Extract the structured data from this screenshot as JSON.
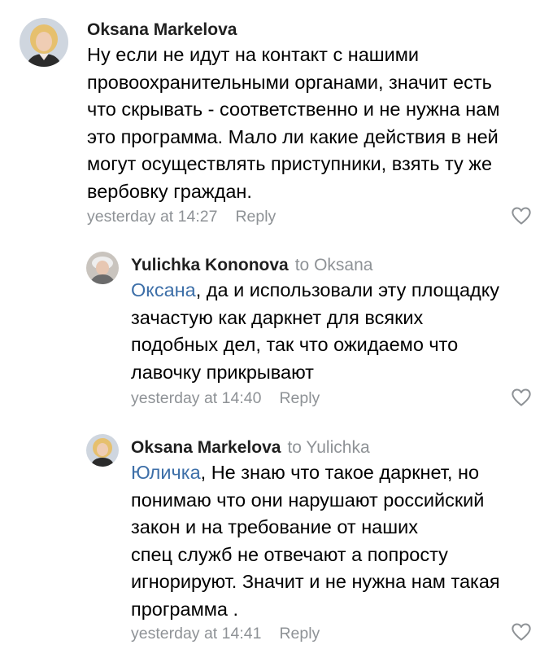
{
  "comments": [
    {
      "author": "Oksana Markelova",
      "to": "",
      "mention": "",
      "lines": [
        "Ну если не идут на контакт с нашими",
        "провоохранительными органами, значит есть",
        "что скрывать - соответственно и не нужна нам",
        "это программа. Мало ли какие действия в ней",
        "могут осуществлять приступники, взять ту же",
        "вербовку граждан."
      ],
      "time": "yesterday at 14:27",
      "reply_label": "Reply",
      "like_icon": "heart-outline"
    },
    {
      "author": "Yulichka Kononova",
      "to": "to Oksana",
      "mention": "Оксана",
      "first_line_rest": ", да и использовали эту площадку",
      "lines": [
        "зачастую как даркнет для всяких",
        "подобных дел, так что ожидаемо что",
        "лавочку прикрывают"
      ],
      "time": "yesterday at 14:40",
      "reply_label": "Reply",
      "like_icon": "heart-outline"
    },
    {
      "author": "Oksana Markelova",
      "to": "to Yulichka",
      "mention": "Юличка",
      "first_line_rest": ", Не знаю что такое даркнет, но",
      "lines": [
        "понимаю что они нарушают российский",
        "закон и на требование от наших",
        "спец служб не отвечают а попросту",
        "игнорируют. Значит и не нужна нам такая",
        "программа ."
      ],
      "time": "yesterday at 14:41",
      "reply_label": "Reply",
      "like_icon": "heart-outline"
    }
  ],
  "colors": {
    "author": "#1f1f1f",
    "meta": "#8e9296",
    "mention": "#3d6fa8",
    "body": "#000000"
  }
}
